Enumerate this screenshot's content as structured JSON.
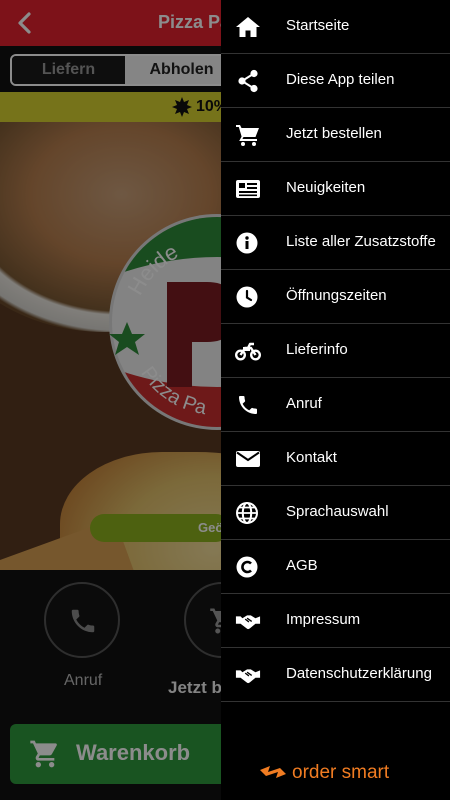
{
  "header": {
    "title": "Pizza Pa"
  },
  "mode_tabs": [
    {
      "label": "Liefern"
    },
    {
      "label": "Abholen"
    }
  ],
  "promo": {
    "text": "10%"
  },
  "hero": {
    "logo_top_text": "Heide",
    "logo_bottom_text": "Pizza Pa"
  },
  "order_strip": {
    "text": "Geö"
  },
  "actions": {
    "call_label": "Anruf",
    "order_label": "Jetzt b"
  },
  "cart": {
    "label": "Warenkorb"
  },
  "colors": {
    "topbar": "#e4212f",
    "promo": "#d8d130",
    "cart": "#2f9a3c",
    "order_strip": "#8db11e",
    "brand": "#f07c22"
  },
  "drawer": {
    "items": [
      {
        "icon": "home-icon",
        "label": "Startseite"
      },
      {
        "icon": "share-icon",
        "label": "Diese App teilen"
      },
      {
        "icon": "cart-icon",
        "label": "Jetzt bestellen"
      },
      {
        "icon": "news-icon",
        "label": "Neuigkeiten"
      },
      {
        "icon": "info-icon",
        "label": "Liste aller Zusatzstoffe"
      },
      {
        "icon": "clock-icon",
        "label": "Öffnungszeiten"
      },
      {
        "icon": "motorcycle-icon",
        "label": "Lieferinfo"
      },
      {
        "icon": "phone-icon",
        "label": "Anruf"
      },
      {
        "icon": "mail-icon",
        "label": "Kontakt"
      },
      {
        "icon": "globe-icon",
        "label": "Sprachauswahl"
      },
      {
        "icon": "copyright-icon",
        "label": "AGB"
      },
      {
        "icon": "handshake-icon",
        "label": "Impressum"
      },
      {
        "icon": "handshake-icon",
        "label": "Datenschutzerklärung"
      }
    ],
    "brand": "order smart"
  }
}
